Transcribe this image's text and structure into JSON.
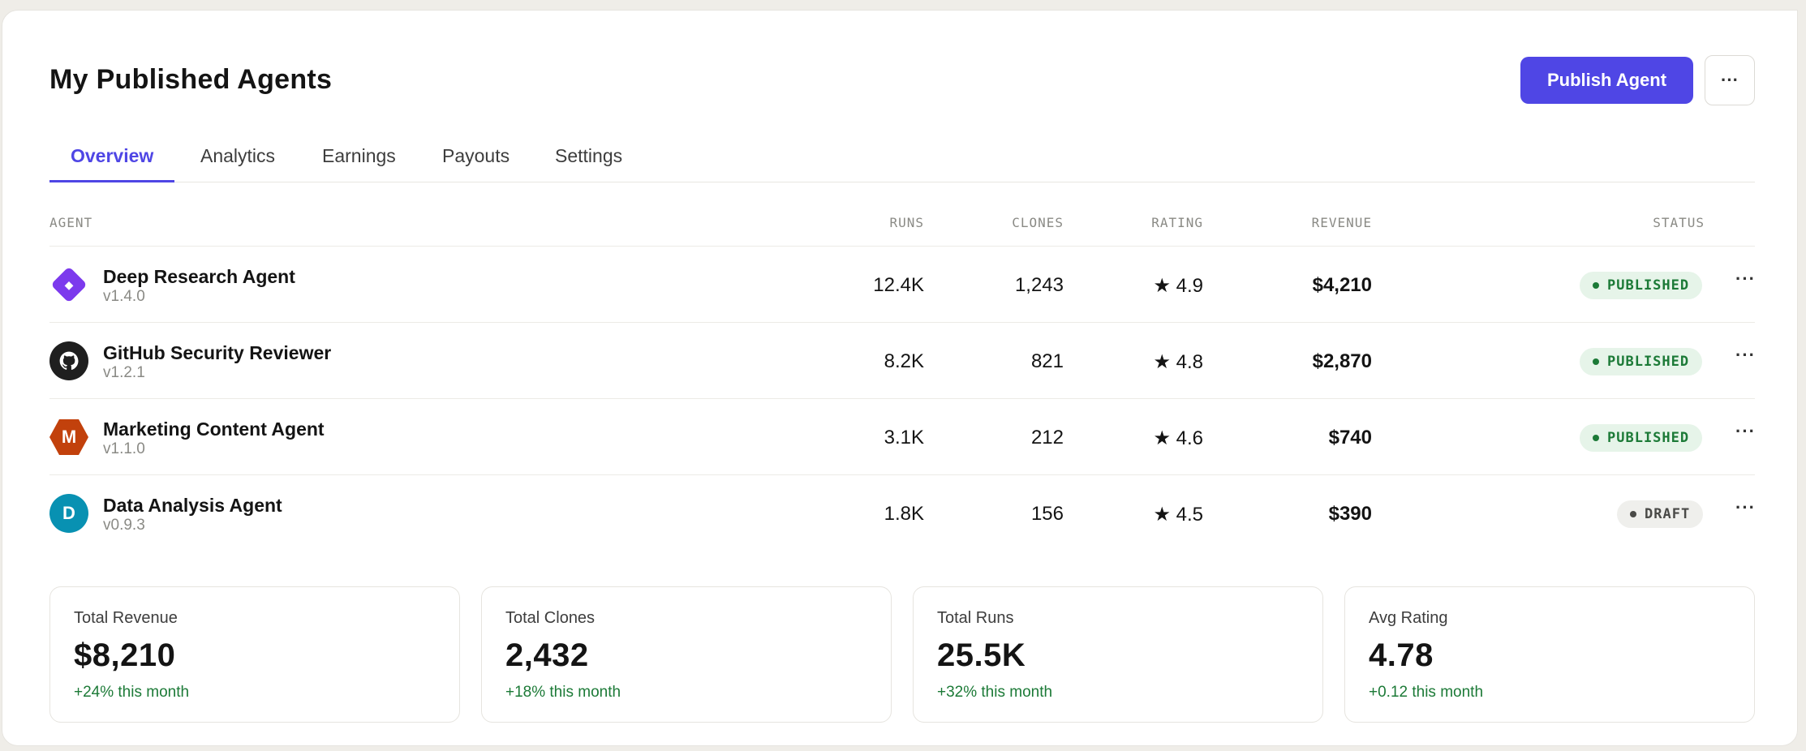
{
  "header": {
    "title": "My Published Agents",
    "publish_label": "Publish Agent",
    "more_label": "···"
  },
  "tabs": [
    {
      "label": "Overview",
      "active": true
    },
    {
      "label": "Analytics",
      "active": false
    },
    {
      "label": "Earnings",
      "active": false
    },
    {
      "label": "Payouts",
      "active": false
    },
    {
      "label": "Settings",
      "active": false
    }
  ],
  "table": {
    "headers": {
      "agent": "AGENT",
      "runs": "RUNS",
      "clones": "CLONES",
      "rating": "RATING",
      "revenue": "REVENUE",
      "status": "STATUS"
    },
    "rows": [
      {
        "name": "Deep Research Agent",
        "version": "v1.4.0",
        "icon": "diamond-icon",
        "icon_glyph": "◆",
        "icon_color": "#7c3aed",
        "runs": "12.4K",
        "clones": "1,243",
        "rating": "★ 4.9",
        "revenue": "$4,210",
        "status": "PUBLISHED",
        "more": "···"
      },
      {
        "name": "GitHub Security Reviewer",
        "version": "v1.2.1",
        "icon": "github-icon",
        "icon_glyph": "",
        "icon_color": "#1f1f1f",
        "runs": "8.2K",
        "clones": "821",
        "rating": "★ 4.8",
        "revenue": "$2,870",
        "status": "PUBLISHED",
        "more": "···"
      },
      {
        "name": "Marketing Content Agent",
        "version": "v1.1.0",
        "icon": "hexagon-m-icon",
        "icon_glyph": "M",
        "icon_color": "#c2410c",
        "runs": "3.1K",
        "clones": "212",
        "rating": "★ 4.6",
        "revenue": "$740",
        "status": "PUBLISHED",
        "more": "···"
      },
      {
        "name": "Data Analysis Agent",
        "version": "v0.9.3",
        "icon": "circle-d-icon",
        "icon_glyph": "D",
        "icon_color": "#0891b2",
        "runs": "1.8K",
        "clones": "156",
        "rating": "★ 4.5",
        "revenue": "$390",
        "status": "DRAFT",
        "more": "···"
      }
    ]
  },
  "stats": [
    {
      "label": "Total Revenue",
      "value": "$8,210",
      "delta": "+24% this month"
    },
    {
      "label": "Total Clones",
      "value": "2,432",
      "delta": "+18% this month"
    },
    {
      "label": "Total Runs",
      "value": "25.5K",
      "delta": "+32% this month"
    },
    {
      "label": "Avg Rating",
      "value": "4.78",
      "delta": "+0.12 this month"
    }
  ],
  "colors": {
    "accent": "#4f46e5",
    "published_bg": "#e6f4e9",
    "published_fg": "#1c7a37",
    "draft_bg": "#efefec",
    "draft_fg": "#4a4a47",
    "delta": "#1c7a37"
  }
}
